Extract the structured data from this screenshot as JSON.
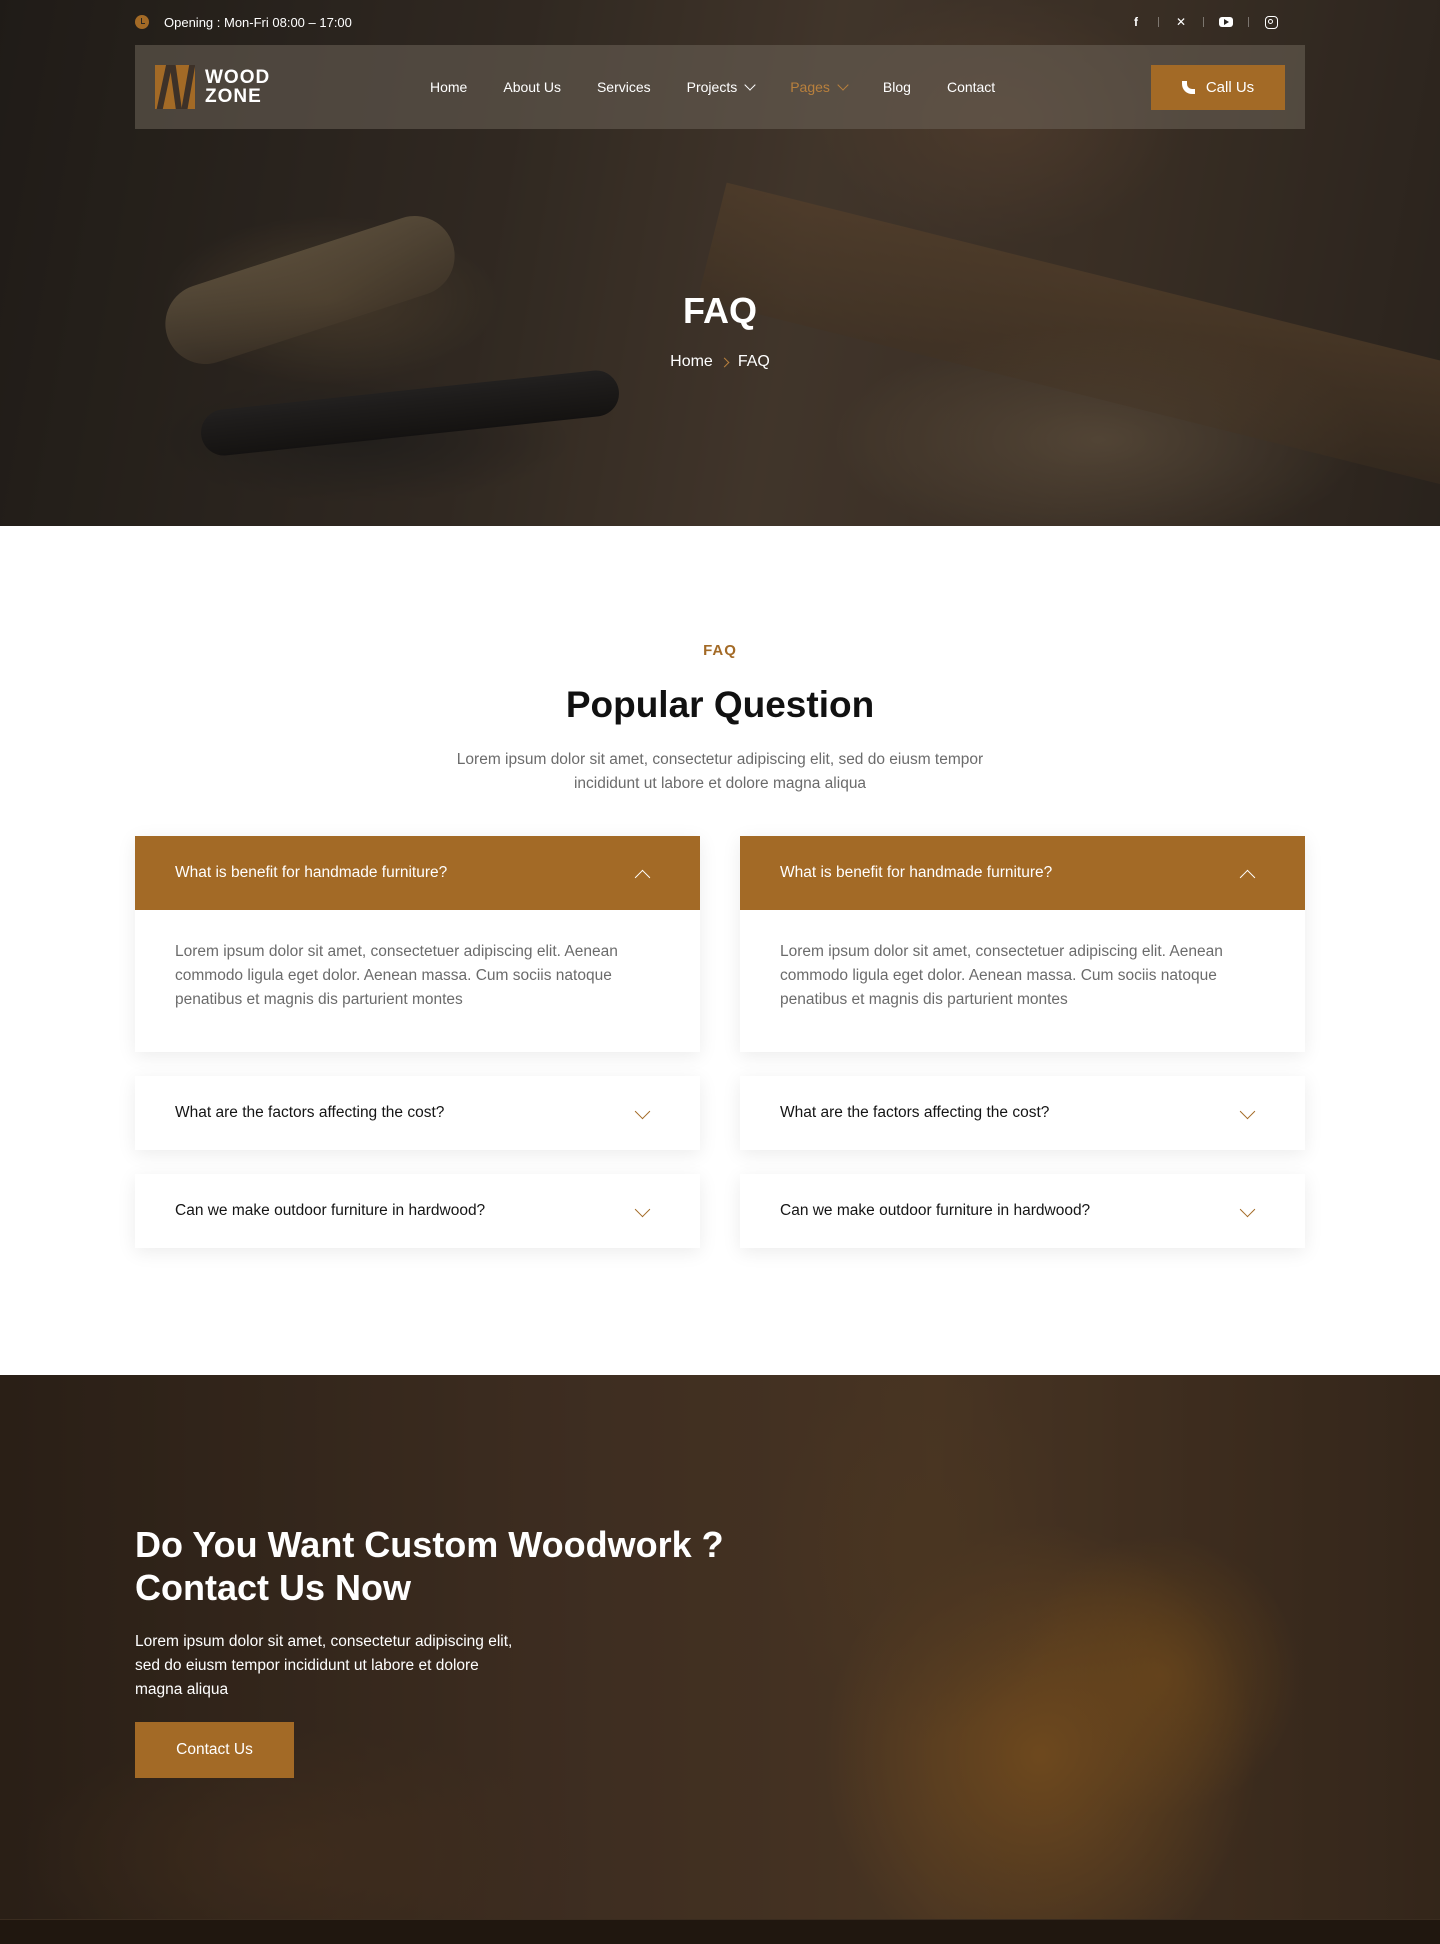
{
  "topbar": {
    "hours": "Opening : Mon-Fri 08:00 – 17:00",
    "socials": [
      {
        "icon": "facebook-icon",
        "glyph": "f"
      },
      {
        "icon": "x-icon",
        "glyph": "✕"
      },
      {
        "icon": "youtube-icon",
        "glyph": ""
      },
      {
        "icon": "instagram-icon",
        "glyph": ""
      }
    ]
  },
  "nav": {
    "logo_line1": "WOOD",
    "logo_line2": "ZONE",
    "items": [
      {
        "label": "Home"
      },
      {
        "label": "About Us"
      },
      {
        "label": "Services"
      },
      {
        "label": "Projects"
      },
      {
        "label": "Pages"
      },
      {
        "label": "Blog"
      },
      {
        "label": "Contact"
      }
    ],
    "call_label": "Call Us"
  },
  "hero": {
    "title": "FAQ",
    "breadcrumb_home": "Home",
    "breadcrumb_current": "FAQ"
  },
  "faq": {
    "tag": "FAQ",
    "title": "Popular Question",
    "description": "Lorem ipsum dolor sit amet, consectetur adipiscing elit, sed do eiusm tempor incididunt ut labore et dolore magna aliqua",
    "left": [
      {
        "question": "What is benefit for handmade furniture?",
        "answer": "Lorem ipsum dolor sit amet, consectetuer adipiscing elit. Aenean commodo ligula eget dolor. Aenean massa. Cum sociis natoque penatibus et magnis dis parturient montes"
      },
      {
        "question": "What are the factors affecting the cost?"
      },
      {
        "question": "Can we make outdoor furniture in hardwood?"
      }
    ],
    "right": [
      {
        "question": "What is benefit for handmade furniture?",
        "answer": "Lorem ipsum dolor sit amet, consectetuer adipiscing elit. Aenean commodo ligula eget dolor. Aenean massa. Cum sociis natoque penatibus et magnis dis parturient montes"
      },
      {
        "question": "What are the factors affecting the cost?"
      },
      {
        "question": "Can we make outdoor furniture in hardwood?"
      }
    ]
  },
  "cta": {
    "title_line1": "Do You Want Custom Woodwork ?",
    "title_line2": "Contact Us Now",
    "text": "Lorem ipsum dolor sit amet, consectetur adipiscing elit, sed do eiusm tempor incididunt ut labore et dolore magna aliqua",
    "button": "Contact Us"
  },
  "colors": {
    "accent": "#a36a26",
    "active_nav": "#b9803d"
  }
}
